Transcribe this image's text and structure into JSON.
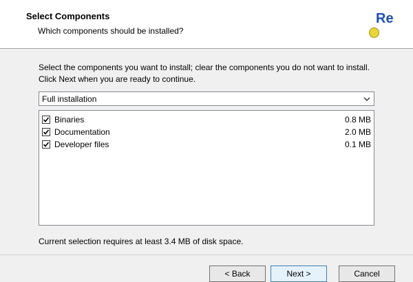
{
  "header": {
    "title": "Select Components",
    "subtitle": "Which components should be installed?",
    "logo_text": "Re"
  },
  "instructions": "Select the components you want to install; clear the components you do not want to install. Click Next when you are ready to continue.",
  "install_type": {
    "selected": "Full installation"
  },
  "components": [
    {
      "label": "Binaries",
      "size": "0.8 MB",
      "checked": true
    },
    {
      "label": "Documentation",
      "size": "2.0 MB",
      "checked": true
    },
    {
      "label": "Developer files",
      "size": "0.1 MB",
      "checked": true
    }
  ],
  "space_note": "Current selection requires at least 3.4 MB of disk space.",
  "buttons": {
    "back": "< Back",
    "next": "Next >",
    "cancel": "Cancel"
  }
}
